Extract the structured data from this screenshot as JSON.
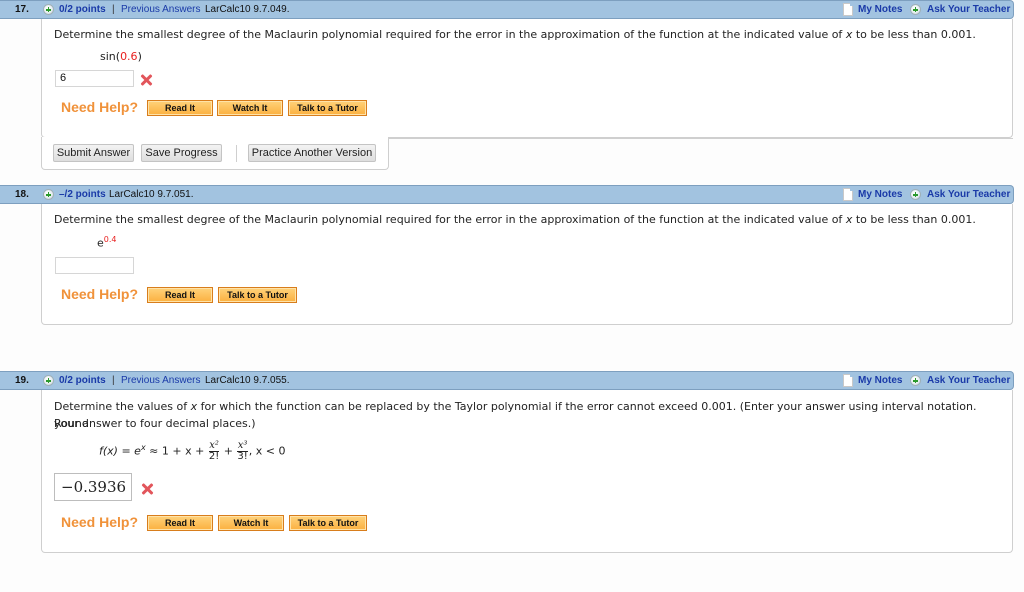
{
  "questions": [
    {
      "number": "17.",
      "points": "0/2 points",
      "separator": "|",
      "previous_answers": "Previous Answers",
      "code": "LarCalc10 9.7.049.",
      "my_notes": "My Notes",
      "ask_teacher": "Ask Your Teacher",
      "prompt": "Determine the smallest degree of the Maclaurin polynomial required for the error in the approximation of the function at the indicated value of x to be less than 0.001.",
      "expr_func": "sin(",
      "expr_value": "0.6",
      "expr_close": ")",
      "answer": "6",
      "answer_status": "incorrect",
      "need_help": "Need Help?",
      "help_buttons": [
        "Read It",
        "Watch It",
        "Talk to a Tutor"
      ],
      "actions": [
        "Submit Answer",
        "Save Progress",
        "Practice Another Version"
      ]
    },
    {
      "number": "18.",
      "points": "–/2 points",
      "code": "LarCalc10 9.7.051.",
      "my_notes": "My Notes",
      "ask_teacher": "Ask Your Teacher",
      "prompt": "Determine the smallest degree of the Maclaurin polynomial required for the error in the approximation of the function at the indicated value of x to be less than 0.001.",
      "expr_base": "e",
      "expr_exponent": "0.4",
      "answer": "",
      "need_help": "Need Help?",
      "help_buttons": [
        "Read It",
        "Talk to a Tutor"
      ]
    },
    {
      "number": "19.",
      "points": "0/2 points",
      "separator": "|",
      "previous_answers": "Previous Answers",
      "code": "LarCalc10 9.7.055.",
      "my_notes": "My Notes",
      "ask_teacher": "Ask Your Teacher",
      "prompt_line1": "Determine the values of x for which the function can be replaced by the Taylor polynomial if the error cannot exceed 0.001. (Enter your answer using interval notation. Round",
      "prompt_line2": "your answer to four decimal places.)",
      "formula": {
        "lhs": "f(x) = e",
        "lhs_exp": "x",
        "approx": " ≈ 1 + x + ",
        "t2_num": "x²",
        "t2_den": "2!",
        "plus": " + ",
        "t3_num": "x³",
        "t3_den": "3!",
        "cond": ",  x < 0"
      },
      "answer": "−0.3936",
      "answer_status": "incorrect",
      "need_help": "Need Help?",
      "help_buttons": [
        "Read It",
        "Watch It",
        "Talk to a Tutor"
      ]
    }
  ]
}
